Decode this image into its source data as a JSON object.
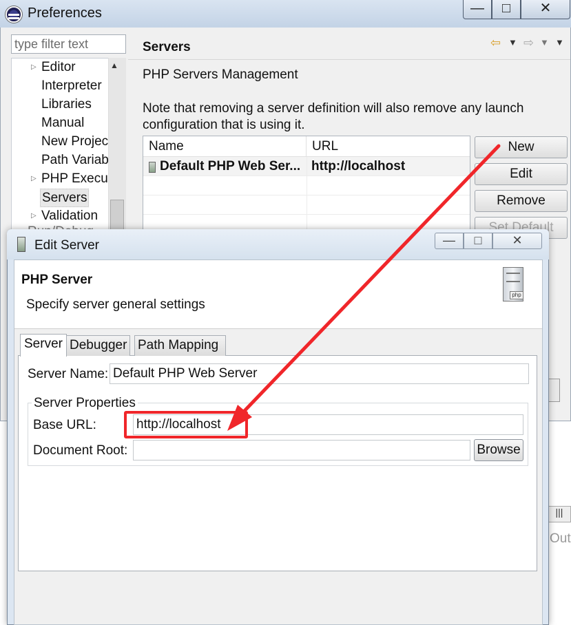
{
  "preferences": {
    "title": "Preferences",
    "filter_placeholder": "type filter text",
    "tree_items": [
      "Editor",
      "Interpreter",
      "Libraries",
      "Manual",
      "New Projec",
      "Path Variab",
      "PHP Execut",
      "Servers",
      "Validation"
    ],
    "ghost_text": "Run/Debug",
    "page_title": "Servers",
    "section_label": "PHP Servers Management",
    "note": "Note that removing a server definition will also remove any launch configuration that is using it.",
    "table": {
      "columns": [
        "Name",
        "URL"
      ],
      "rows": [
        {
          "name": "Default PHP Web Ser...",
          "url": "http://localhost"
        }
      ]
    },
    "buttons": {
      "new": "New",
      "edit": "Edit",
      "remove": "Remove",
      "set_default": "Set Default"
    },
    "ghost_right": "Out"
  },
  "edit_server": {
    "title": "Edit Server",
    "banner_title": "PHP Server",
    "banner_desc": "Specify server general settings",
    "banner_icon_text": "php",
    "tabs": [
      "Server",
      "Debugger",
      "Path Mapping"
    ],
    "server_name_label": "Server Name:",
    "server_name_value": "Default PHP Web Server",
    "group_title": "Server Properties",
    "base_url_label": "Base URL:",
    "base_url_value": "http://localhost",
    "doc_root_label": "Document Root:",
    "doc_root_value": "",
    "browse_label": "Browse"
  },
  "colors": {
    "annotation": "#f0262a",
    "accent_back": "#d9a12e"
  }
}
